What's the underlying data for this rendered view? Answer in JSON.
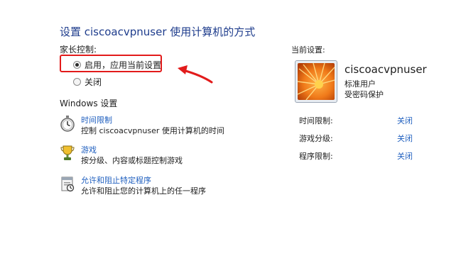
{
  "title": "设置 ciscoacvpnuser 使用计算机的方式",
  "parental_controls": {
    "label": "家长控制:",
    "options": [
      {
        "label": "启用，应用当前设置",
        "checked": true
      },
      {
        "label": "关闭",
        "checked": false
      }
    ]
  },
  "windows_settings": {
    "label": "Windows 设置",
    "items": [
      {
        "icon": "stopwatch-icon",
        "link": "时间限制",
        "desc": "控制 ciscoacvpnuser 使用计算机的时间"
      },
      {
        "icon": "game-trophy-icon",
        "link": "游戏",
        "desc": "按分级、内容或标题控制游戏"
      },
      {
        "icon": "program-block-icon",
        "link": "允许和阻止特定程序",
        "desc": "允许和阻止您的计算机上的任一程序"
      }
    ]
  },
  "current_settings": {
    "label": "当前设置:",
    "user": {
      "name": "ciscoacvpnuser",
      "type": "标准用户",
      "protection": "受密码保护"
    },
    "rows": [
      {
        "key": "时间限制:",
        "value": "关闭"
      },
      {
        "key": "游戏分级:",
        "value": "关闭"
      },
      {
        "key": "程序限制:",
        "value": "关闭"
      }
    ]
  },
  "colors": {
    "link": "#1f5fbf",
    "title": "#1e3c8c",
    "annotation": "#e21b1b"
  }
}
